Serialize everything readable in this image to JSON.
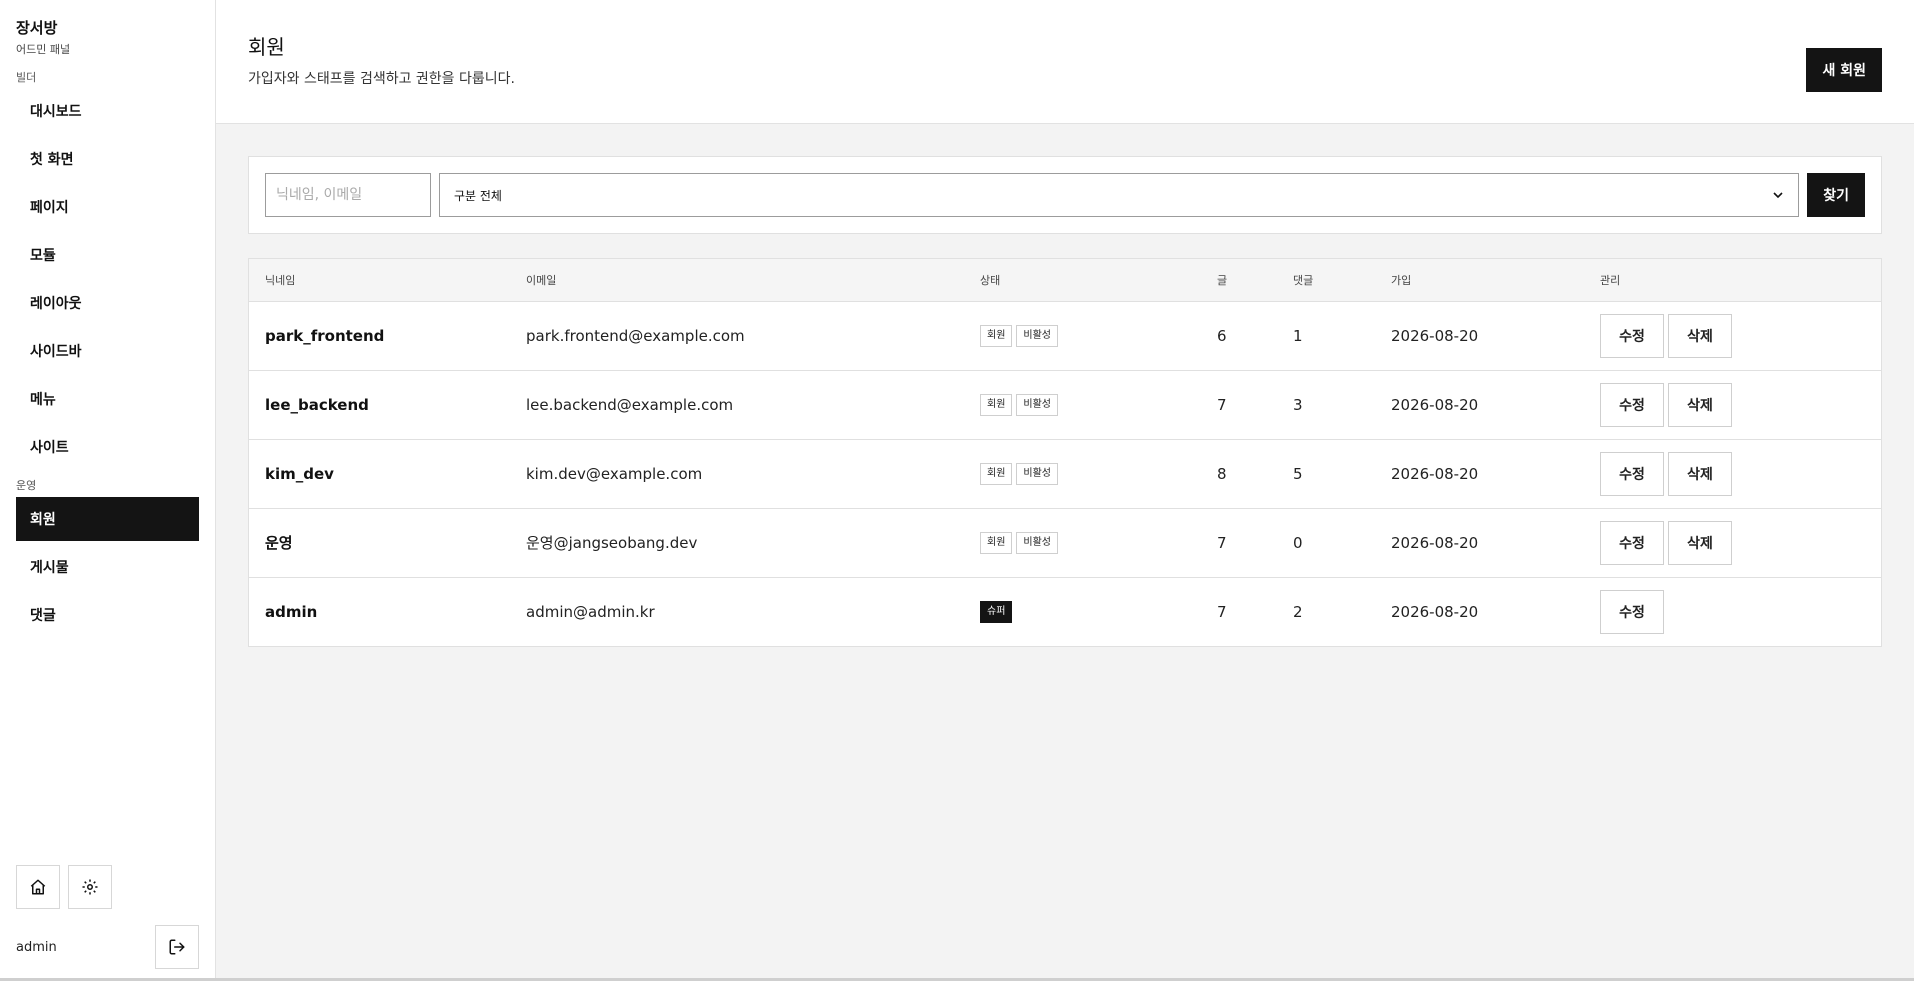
{
  "sidebar": {
    "brand_title": "장서방",
    "brand_sub": "어드민 패널",
    "section_builder": "빌더",
    "builder_items": [
      {
        "label": "대시보드"
      },
      {
        "label": "첫 화면"
      },
      {
        "label": "페이지"
      },
      {
        "label": "모듈"
      },
      {
        "label": "레이아웃"
      },
      {
        "label": "사이드바"
      },
      {
        "label": "메뉴"
      },
      {
        "label": "사이트"
      }
    ],
    "section_ops": "운영",
    "ops_items": [
      {
        "label": "회원",
        "active": true
      },
      {
        "label": "게시물"
      },
      {
        "label": "댓글"
      }
    ],
    "user_name": "admin"
  },
  "header": {
    "title": "회원",
    "subtitle": "가입자와 스태프를 검색하고 권한을 다룹니다.",
    "new_button": "새 회원"
  },
  "search": {
    "placeholder": "닉네임, 이메일",
    "select_value": "구분 전체",
    "find_button": "찾기"
  },
  "table": {
    "columns": [
      "닉네임",
      "이메일",
      "상태",
      "글",
      "댓글",
      "가입",
      "관리"
    ],
    "rows": [
      {
        "nick": "park_frontend",
        "email": "park.frontend@example.com",
        "badges": [
          "회원",
          "비활성"
        ],
        "posts": "6",
        "comments": "1",
        "joined": "2026-08-20",
        "actions": [
          "수정",
          "삭제"
        ]
      },
      {
        "nick": "lee_backend",
        "email": "lee.backend@example.com",
        "badges": [
          "회원",
          "비활성"
        ],
        "posts": "7",
        "comments": "3",
        "joined": "2026-08-20",
        "actions": [
          "수정",
          "삭제"
        ]
      },
      {
        "nick": "kim_dev",
        "email": "kim.dev@example.com",
        "badges": [
          "회원",
          "비활성"
        ],
        "posts": "8",
        "comments": "5",
        "joined": "2026-08-20",
        "actions": [
          "수정",
          "삭제"
        ]
      },
      {
        "nick": "운영",
        "email": "운영@jangseobang.dev",
        "badges": [
          "회원",
          "비활성"
        ],
        "posts": "7",
        "comments": "0",
        "joined": "2026-08-20",
        "actions": [
          "수정",
          "삭제"
        ]
      },
      {
        "nick": "admin",
        "email": "admin@admin.kr",
        "badges": [
          "슈퍼"
        ],
        "badge_dark": true,
        "posts": "7",
        "comments": "2",
        "joined": "2026-08-20",
        "actions": [
          "수정"
        ]
      }
    ]
  },
  "colors": {
    "accent_dark": "#141414",
    "background": "#f3f3f3"
  }
}
